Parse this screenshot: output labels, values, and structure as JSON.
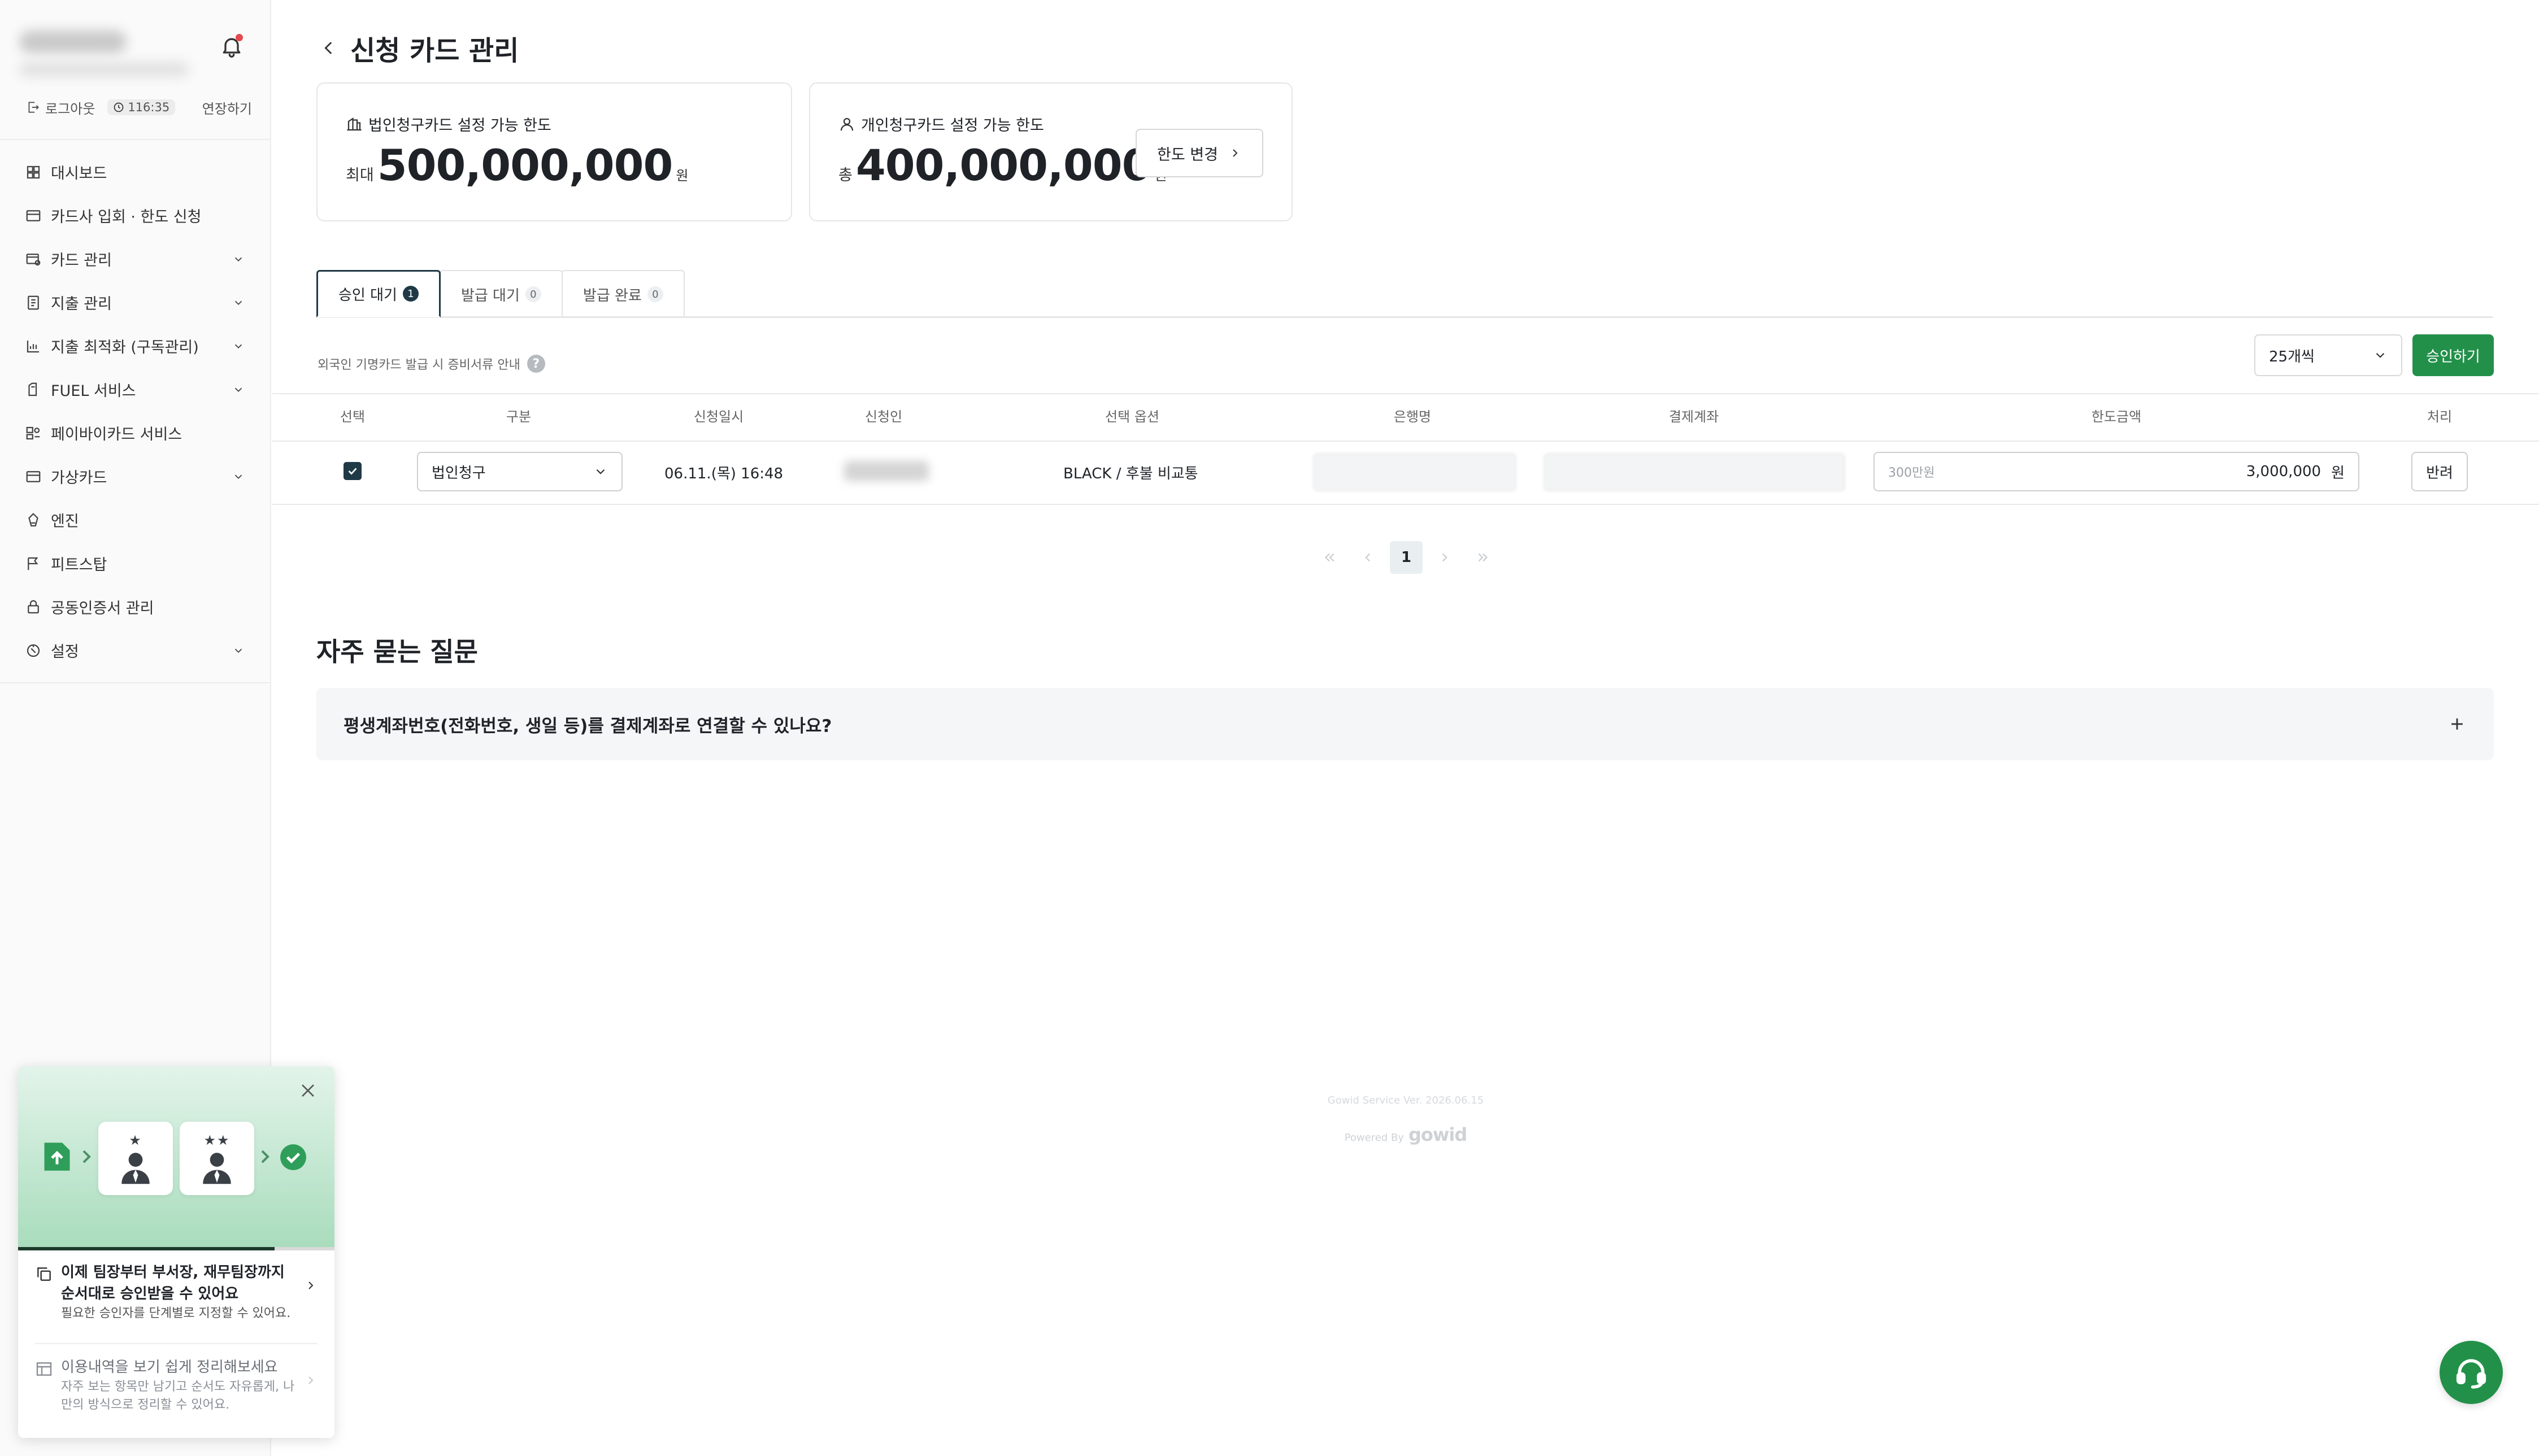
{
  "sidebar": {
    "session": {
      "logout": "로그아웃",
      "timer": "116:35",
      "extend": "연장하기"
    },
    "items": [
      {
        "label": "대시보드",
        "icon": "dashboard-icon"
      },
      {
        "label": "카드사 입회 · 한도 신청",
        "icon": "card-icon"
      },
      {
        "label": "카드 관리",
        "icon": "card-settings-icon"
      },
      {
        "label": "지출 관리",
        "icon": "document-icon"
      },
      {
        "label": "지출 최적화 (구독관리)",
        "icon": "chart-icon"
      },
      {
        "label": "FUEL 서비스",
        "icon": "fuel-icon"
      },
      {
        "label": "페이바이카드 서비스",
        "icon": "paybycard-icon"
      },
      {
        "label": "가상카드",
        "icon": "virtual-card-icon"
      },
      {
        "label": "엔진",
        "icon": "engine-icon"
      },
      {
        "label": "피트스탑",
        "icon": "flag-icon"
      },
      {
        "label": "공동인증서 관리",
        "icon": "lock-icon"
      },
      {
        "label": "설정",
        "icon": "settings-icon"
      }
    ]
  },
  "promo": {
    "item1": {
      "title": "이제 팀장부터 부서장, 재무팀장까지 순서대로 승인받을 수 있어요",
      "desc": "필요한 승인자를 단계별로 지정할 수 있어요."
    },
    "item2": {
      "title": "이용내역을 보기 쉽게 정리해보세요",
      "desc": "자주 보는 항목만 남기고 순서도 자유롭게, 나만의 방식으로 정리할 수 있어요."
    },
    "progress": 0.81
  },
  "page": {
    "title": "신청 카드 관리"
  },
  "limits": {
    "corporate": {
      "title": "법인청구카드 설정 가능 한도",
      "prefix": "최대",
      "amount": "500,000,000",
      "unit": "원"
    },
    "personal": {
      "title": "개인청구카드 설정 가능 한도",
      "prefix": "총",
      "amount": "400,000,000",
      "unit": "원"
    },
    "change_button": "한도 변경"
  },
  "tabs": [
    {
      "label": "승인 대기",
      "count": "1",
      "active": true
    },
    {
      "label": "발급 대기",
      "count": "0",
      "active": false
    },
    {
      "label": "발급 완료",
      "count": "0",
      "active": false
    }
  ],
  "toolbar": {
    "foreign_note": "외국인 기명카드 발급 시 증비서류 안내",
    "help": "?",
    "page_size": "25개씩",
    "approve_button": "승인하기"
  },
  "table": {
    "headers": [
      "선택",
      "구분",
      "신청일시",
      "신청인",
      "선택 옵션",
      "은행명",
      "결제계좌",
      "한도금액",
      "처리"
    ],
    "rows": [
      {
        "checked": true,
        "type": "법인청구",
        "datetime": "06.11.(목) 16:48",
        "option": "BLACK / 후불 비교통",
        "amount_placeholder": "300만원",
        "amount": "3,000,000",
        "amount_unit": "원",
        "action": "반려"
      }
    ]
  },
  "pagination": {
    "current": "1"
  },
  "faq": {
    "title": "자주 묻는 질문",
    "items": [
      {
        "question": "평생계좌번호(전화번호, 생일 등)를 결제계좌로 연결할 수 있나요?"
      }
    ]
  },
  "footer": {
    "version": "Gowid Service Ver. 2026.06.15",
    "powered_by": "Powered By",
    "logo": "gowid"
  },
  "colors": {
    "accent": "#23904a",
    "dark": "#1f3a46"
  }
}
